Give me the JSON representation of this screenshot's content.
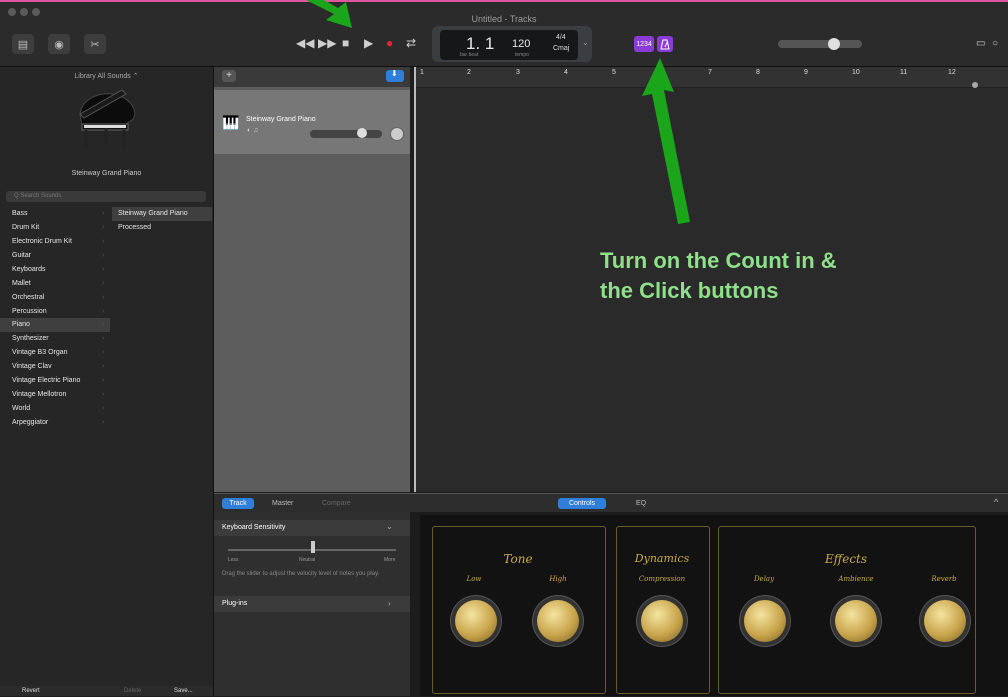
{
  "window": {
    "title": "Untitled - Tracks"
  },
  "transport": {
    "position": "1. 1",
    "position_sub": "bar   beat",
    "tempo": "120",
    "tempo_sub": "tempo",
    "time_signature": "4/4",
    "key": "Cmaj",
    "count_in_label": "1234",
    "metronome_icon": "metronome-icon"
  },
  "library": {
    "header": "Library  All Sounds ⌃",
    "instrument_name": "Steinway Grand Piano",
    "search_placeholder": "Q  Search Sounds",
    "categories": [
      "Bass",
      "Drum Kit",
      "Electronic Drum Kit",
      "Guitar",
      "Keyboards",
      "Mallet",
      "Orchestral",
      "Percussion",
      "Piano",
      "Synthesizer",
      "Vintage B3 Organ",
      "Vintage Clav",
      "Vintage Electric Piano",
      "Vintage Mellotron",
      "World",
      "Arpeggiator"
    ],
    "selected_category": "Piano",
    "subcategories": [
      "Steinway Grand Piano",
      "Processed"
    ],
    "footer": {
      "revert": "Revert",
      "delete": "Delete",
      "save": "Save..."
    }
  },
  "tracks": {
    "add_button": "+",
    "track_name": "Steinway Grand Piano",
    "ruler": [
      "1",
      "2",
      "3",
      "4",
      "5",
      "6",
      "7",
      "8",
      "9",
      "10",
      "11",
      "12"
    ]
  },
  "smart_controls": {
    "tabs": [
      "Track",
      "Master",
      "Compare"
    ],
    "center_tabs": [
      "Controls",
      "EQ"
    ],
    "keyboard_sensitivity": "Keyboard Sensitivity",
    "slider_labels": [
      "Less",
      "Neutral",
      "More"
    ],
    "help_text": "Drag the slider to adjust the velocity level of notes you play.",
    "plugins": "Plug-ins",
    "groups": {
      "tone": "Tone",
      "dynamics": "Dynamics",
      "effects": "Effects"
    },
    "knobs": [
      "Low",
      "High",
      "Compression",
      "Delay",
      "Ambience",
      "Reverb"
    ]
  },
  "annotation": {
    "line1": "Turn on the Count in &",
    "line2": "the Click buttons",
    "color": "#8fe08a",
    "arrow_color": "#1aa51a"
  }
}
